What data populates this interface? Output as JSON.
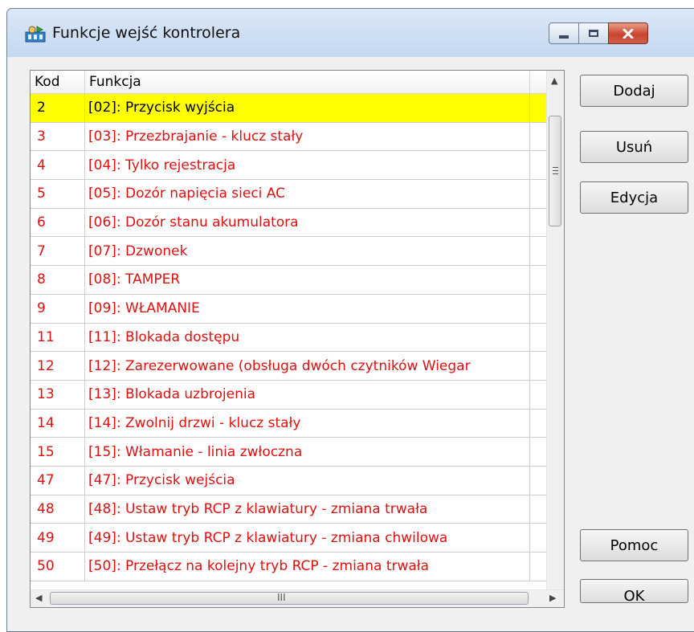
{
  "window": {
    "title": "Funkcje wejść kontrolera"
  },
  "list": {
    "columns": [
      "Kod",
      "Funkcja"
    ],
    "rows": [
      {
        "kod": "2",
        "funkcja": "[02]: Przycisk wyjścia",
        "selected": true
      },
      {
        "kod": "3",
        "funkcja": "[03]: Przezbrajanie - klucz stały"
      },
      {
        "kod": "4",
        "funkcja": "[04]: Tylko rejestracja"
      },
      {
        "kod": "5",
        "funkcja": "[05]: Dozór napięcia sieci AC"
      },
      {
        "kod": "6",
        "funkcja": "[06]: Dozór stanu akumulatora"
      },
      {
        "kod": "7",
        "funkcja": "[07]: Dzwonek"
      },
      {
        "kod": "8",
        "funkcja": "[08]: TAMPER"
      },
      {
        "kod": "9",
        "funkcja": "[09]: WŁAMANIE"
      },
      {
        "kod": "11",
        "funkcja": "[11]: Blokada dostępu"
      },
      {
        "kod": "12",
        "funkcja": "[12]: Zarezerwowane (obsługa dwóch czytników Wiegar"
      },
      {
        "kod": "13",
        "funkcja": "[13]: Blokada uzbrojenia"
      },
      {
        "kod": "14",
        "funkcja": "[14]: Zwolnij drzwi - klucz stały"
      },
      {
        "kod": "15",
        "funkcja": "[15]: Włamanie - linia zwłoczna"
      },
      {
        "kod": "47",
        "funkcja": "[47]: Przycisk wejścia"
      },
      {
        "kod": "48",
        "funkcja": "[48]: Ustaw tryb RCP z klawiatury - zmiana trwała"
      },
      {
        "kod": "49",
        "funkcja": "[49]: Ustaw tryb RCP z klawiatury - zmiana chwilowa"
      },
      {
        "kod": "50",
        "funkcja": "[50]: Przełącz na kolejny tryb RCP - zmiana trwała"
      }
    ]
  },
  "buttons": {
    "dodaj": "Dodaj",
    "usun": "Usuń",
    "edycja": "Edycja",
    "pomoc": "Pomoc",
    "ok": "OK"
  },
  "hscroll_grip": "III",
  "colors": {
    "selected_row": "#ffff00",
    "row_text": "#e01010"
  }
}
